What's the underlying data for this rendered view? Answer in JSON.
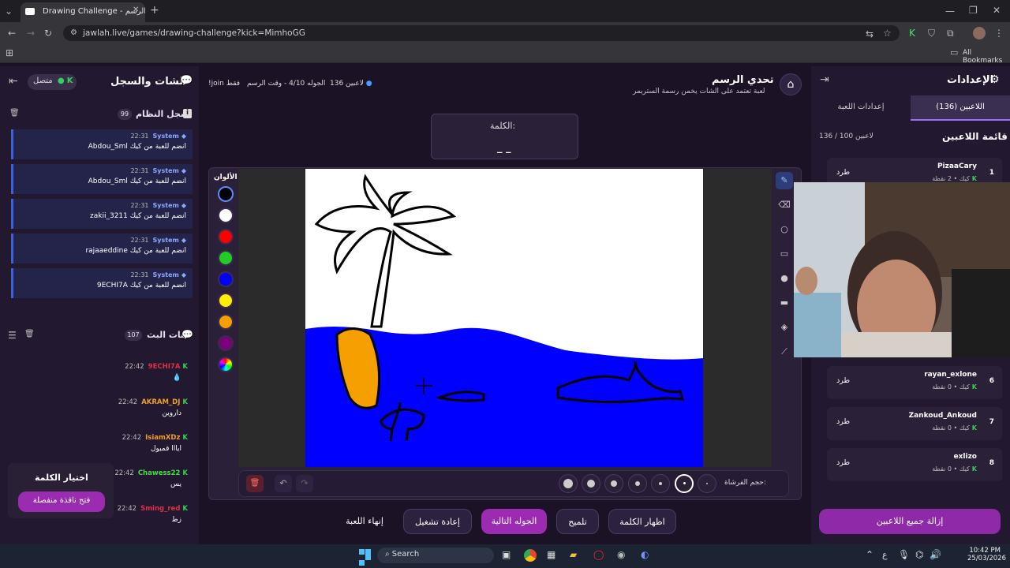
{
  "browser": {
    "tab_title": "Drawing Challenge - تحدي الرسم",
    "url": "jawlah.live/games/drawing-challenge?kick=MimhoGG",
    "bookmarks_label": "All Bookmarks"
  },
  "chat_panel": {
    "title": "الشات والسجل",
    "status": "متصل",
    "system_log_title": "سجل النظام",
    "system_log_count": "99",
    "system_messages": [
      {
        "sender": "System",
        "time": "22:31",
        "text": "Abdou_Sml انضم للعبة من كيك"
      },
      {
        "sender": "System",
        "time": "22:31",
        "text": "Abdou_Sml انضم للعبة من كيك"
      },
      {
        "sender": "System",
        "time": "22:31",
        "text": "zakii_3211 انضم للعبة من كيك"
      },
      {
        "sender": "System",
        "time": "22:31",
        "text": "rajaaeddine انضم للعبة من كيك"
      },
      {
        "sender": "System",
        "time": "22:31",
        "text": "9ECHI7A انضم للعبة من كيك"
      }
    ],
    "stream_chat_title": "شات البث",
    "stream_chat_count": "107",
    "stream_messages": [
      {
        "user": "9ECHI7A",
        "time": "22:42",
        "text": "💧",
        "color": "#e0304a"
      },
      {
        "user": "AKRAM_DJ",
        "time": "22:42",
        "text": "داروين",
        "color": "#f0a020"
      },
      {
        "user": "IsiamXDz",
        "time": "22:42",
        "text": "ايااا قمبول",
        "color": "#f0a020"
      },
      {
        "user": "Chawess22",
        "time": "22:42",
        "text": "يس",
        "color": "#40e040"
      },
      {
        "user": "Sming_red",
        "time": "22:42",
        "text": "زط",
        "color": "#e0304a"
      }
    ],
    "choose_word": {
      "title": "اختيار الكلمة",
      "button": "فتح نافذة منفصلة"
    }
  },
  "header": {
    "game_title": "تحدي الرسم",
    "game_subtitle": "لعبة تعتمد على الشات يخمن رسمة الستريمر",
    "players_count": "136 لاعبين",
    "round_info": "الجوله 4/10 - وقت الرسم",
    "join_info": "!join فقط"
  },
  "word_box": {
    "label": "الكلمة:",
    "value": "_ _"
  },
  "canvas": {
    "colors_label": "الألوان",
    "colors": [
      "#000000",
      "#ffffff",
      "#ff0000",
      "#22cc22",
      "#0000ff",
      "#ffee00",
      "#f5a000",
      "#7b007b"
    ],
    "brush_size_label": "حجم الفرشاة:"
  },
  "controls": {
    "show_word": "اظهار الكلمة",
    "hint": "تلميح",
    "next_round": "الجوله التالية",
    "restart": "إعادة تشغيل",
    "end_game": "إنهاء اللعبة"
  },
  "settings_panel": {
    "title": "الإعدادات",
    "tab_players": "اللاعبين (136)",
    "tab_game": "إعدادات اللعبة",
    "list_title": "قائمة اللاعبين",
    "list_count": "136 / 100 لاعبين",
    "kick_label": "طرد",
    "players": [
      {
        "rank": "1",
        "name": "PizaaCary",
        "meta": "كيك • 2 نقطة"
      },
      {
        "rank": "6",
        "name": "rayan_exlone",
        "meta": "كيك • 0 نقطة"
      },
      {
        "rank": "7",
        "name": "Zankoud_Ankoud",
        "meta": "كيك • 0 نقطة"
      },
      {
        "rank": "8",
        "name": "exlizo",
        "meta": "كيك • 0 نقطة"
      }
    ],
    "remove_all": "إزالة جميع اللاعبين"
  },
  "taskbar": {
    "search": "Search",
    "time": "10:42 PM",
    "date": "25/03/2026",
    "lang": "ع"
  }
}
